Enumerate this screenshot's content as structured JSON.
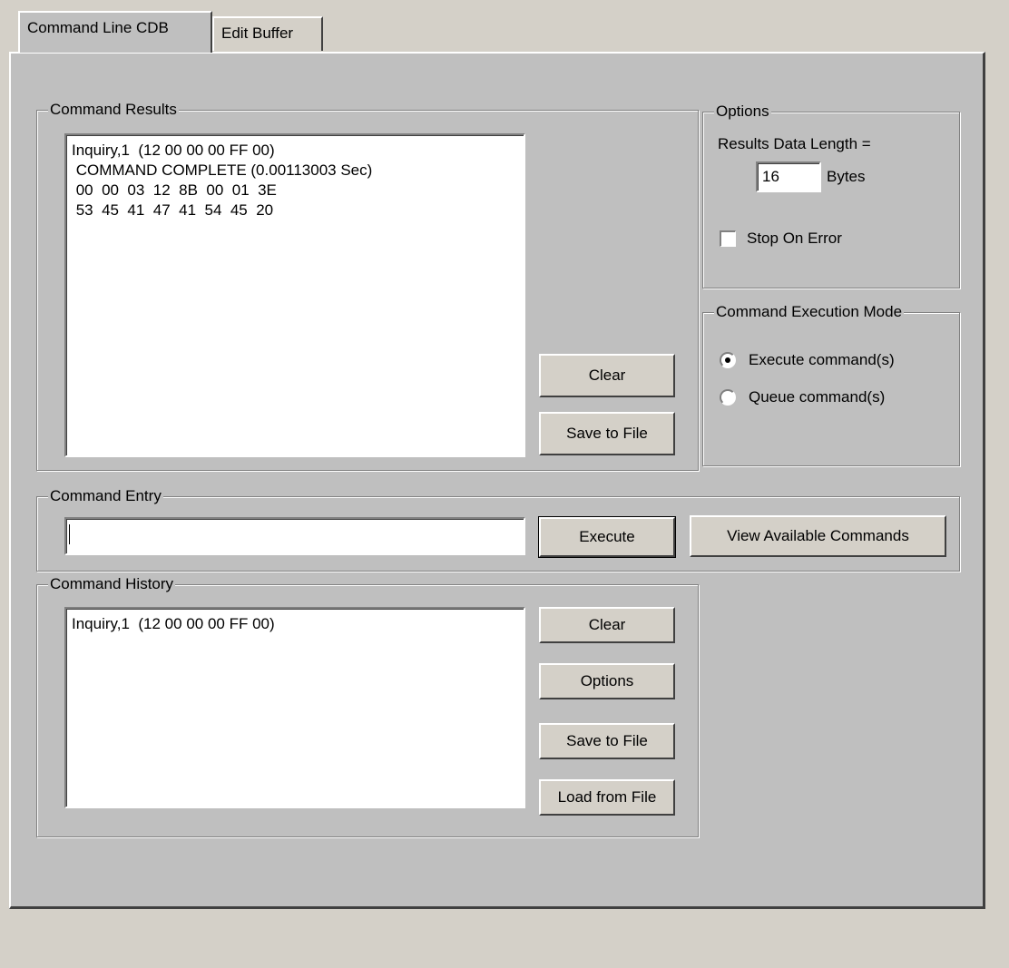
{
  "tabs": [
    {
      "label": "Command Line CDB"
    },
    {
      "label": "Edit Buffer"
    }
  ],
  "command_results": {
    "legend": "Command Results",
    "lines": [
      "Inquiry,1  (12 00 00 00 FF 00)",
      " COMMAND COMPLETE (0.00113003 Sec)",
      " 00  00  03  12  8B  00  01  3E",
      " 53  45  41  47  41  54  45  20"
    ],
    "clear_label": "Clear",
    "save_label": "Save to File"
  },
  "options": {
    "legend": "Options",
    "results_length_label": "Results Data Length =",
    "results_length_value": "16",
    "bytes_label": "Bytes",
    "stop_on_error_label": "Stop On Error",
    "stop_on_error_checked": false
  },
  "execution_mode": {
    "legend": "Command Execution Mode",
    "options": [
      {
        "label": "Execute command(s)",
        "selected": true
      },
      {
        "label": "Queue command(s)",
        "selected": false
      }
    ]
  },
  "command_entry": {
    "legend": "Command Entry",
    "value": "",
    "execute_label": "Execute",
    "view_commands_label": "View Available Commands"
  },
  "command_history": {
    "legend": "Command History",
    "lines": [
      "Inquiry,1  (12 00 00 00 FF 00)"
    ],
    "clear_label": "Clear",
    "options_label": "Options",
    "save_label": "Save to File",
    "load_label": "Load from File"
  }
}
